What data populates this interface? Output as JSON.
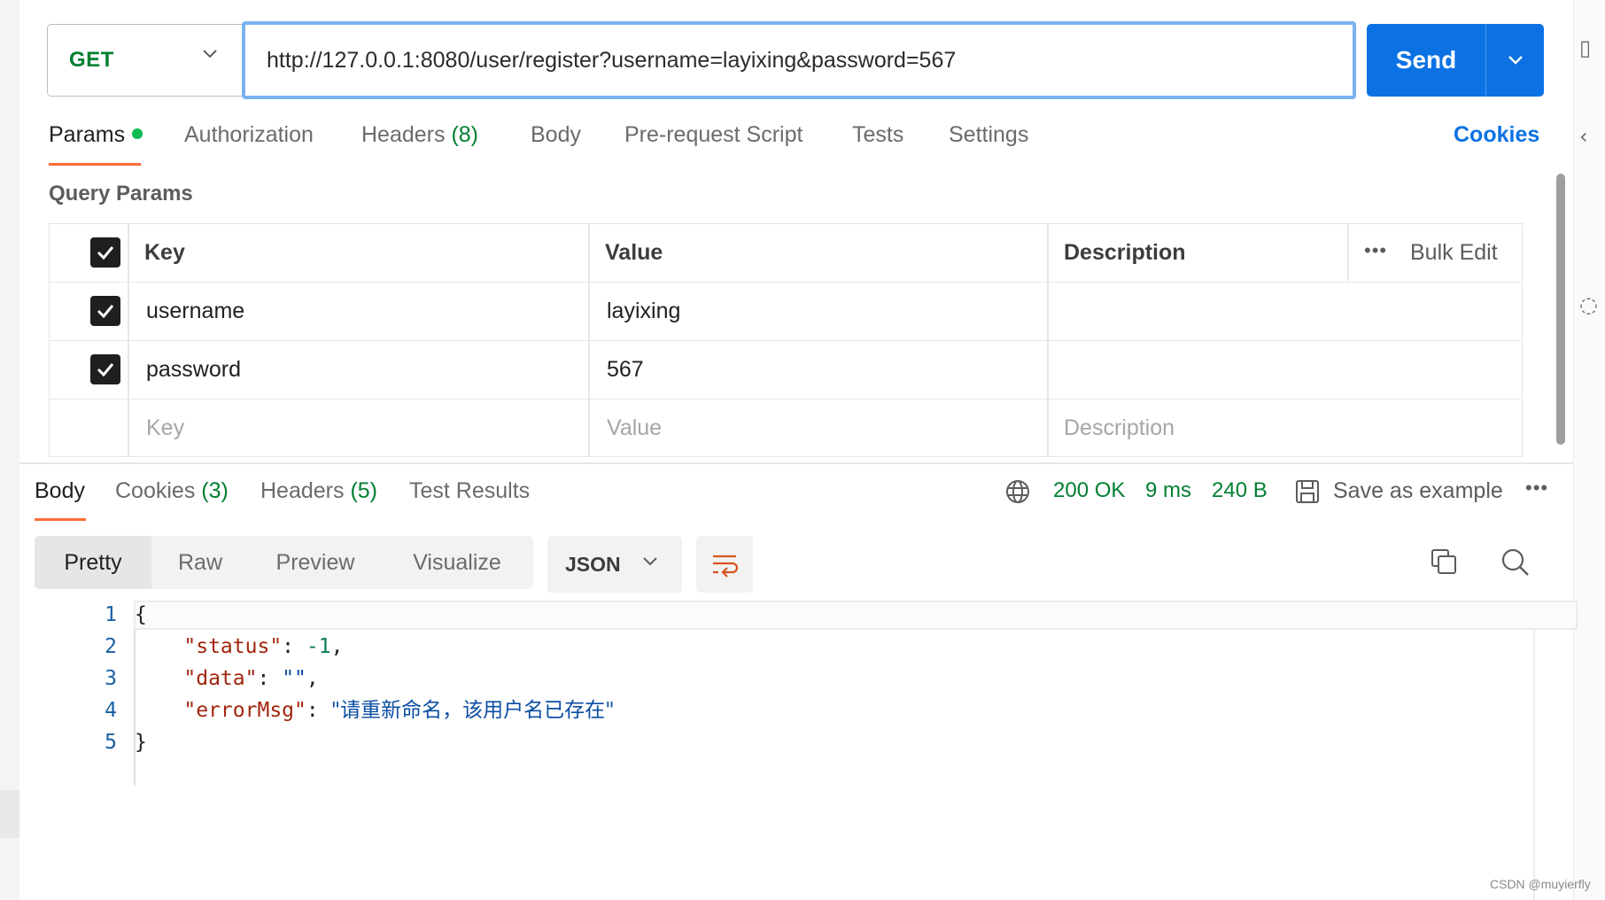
{
  "request": {
    "method": "GET",
    "url": "http://127.0.0.1:8080/user/register?username=layixing&password=567",
    "send_label": "Send"
  },
  "request_tabs": [
    {
      "label": "Params",
      "count": ""
    },
    {
      "label": "Authorization",
      "count": ""
    },
    {
      "label": "Headers",
      "count": "(8)"
    },
    {
      "label": "Body",
      "count": ""
    },
    {
      "label": "Pre-request Script",
      "count": ""
    },
    {
      "label": "Tests",
      "count": ""
    },
    {
      "label": "Settings",
      "count": ""
    }
  ],
  "cookies_link": "Cookies",
  "query_params": {
    "title": "Query Params",
    "headers": {
      "key": "Key",
      "value": "Value",
      "description": "Description",
      "bulk_edit": "Bulk Edit",
      "more": "•••"
    },
    "rows": [
      {
        "key": "username",
        "value": "layixing",
        "description": "",
        "checked": true
      },
      {
        "key": "password",
        "value": "567",
        "description": "",
        "checked": true
      }
    ],
    "placeholders": {
      "key": "Key",
      "value": "Value",
      "description": "Description"
    }
  },
  "response_tabs": [
    {
      "label": "Body",
      "count": ""
    },
    {
      "label": "Cookies",
      "count": "(3)"
    },
    {
      "label": "Headers",
      "count": "(5)"
    },
    {
      "label": "Test Results",
      "count": ""
    }
  ],
  "response_status": {
    "status": "200 OK",
    "time": "9 ms",
    "size": "240 B",
    "save_example": "Save as example",
    "more": "•••"
  },
  "body_views": [
    "Pretty",
    "Raw",
    "Preview",
    "Visualize"
  ],
  "format_select": "JSON",
  "code": {
    "line_numbers": [
      "1",
      "2",
      "3",
      "4",
      "5"
    ],
    "open_brace": "{",
    "close_brace": "}",
    "fields": [
      {
        "key": "\"status\"",
        "value": "-1",
        "type": "number",
        "trail": ","
      },
      {
        "key": "\"data\"",
        "value": "\"\"",
        "type": "string",
        "trail": ","
      },
      {
        "key": "\"errorMsg\"",
        "value": "\"请重新命名，该用户名已存在\"",
        "type": "string",
        "trail": ""
      }
    ]
  },
  "watermark": "CSDN @muyierfly",
  "colors": {
    "accent": "#0c72e3",
    "success": "#007f31",
    "active_tab": "#ff6c37",
    "json_key": "#a1260d",
    "json_number": "#097c5a",
    "json_string": "#0c4ea3"
  },
  "icons": [
    "chevron-down-icon",
    "globe-icon",
    "save-icon",
    "wrap-lines-icon",
    "copy-icon",
    "search-icon",
    "checkbox-checked-icon"
  ]
}
